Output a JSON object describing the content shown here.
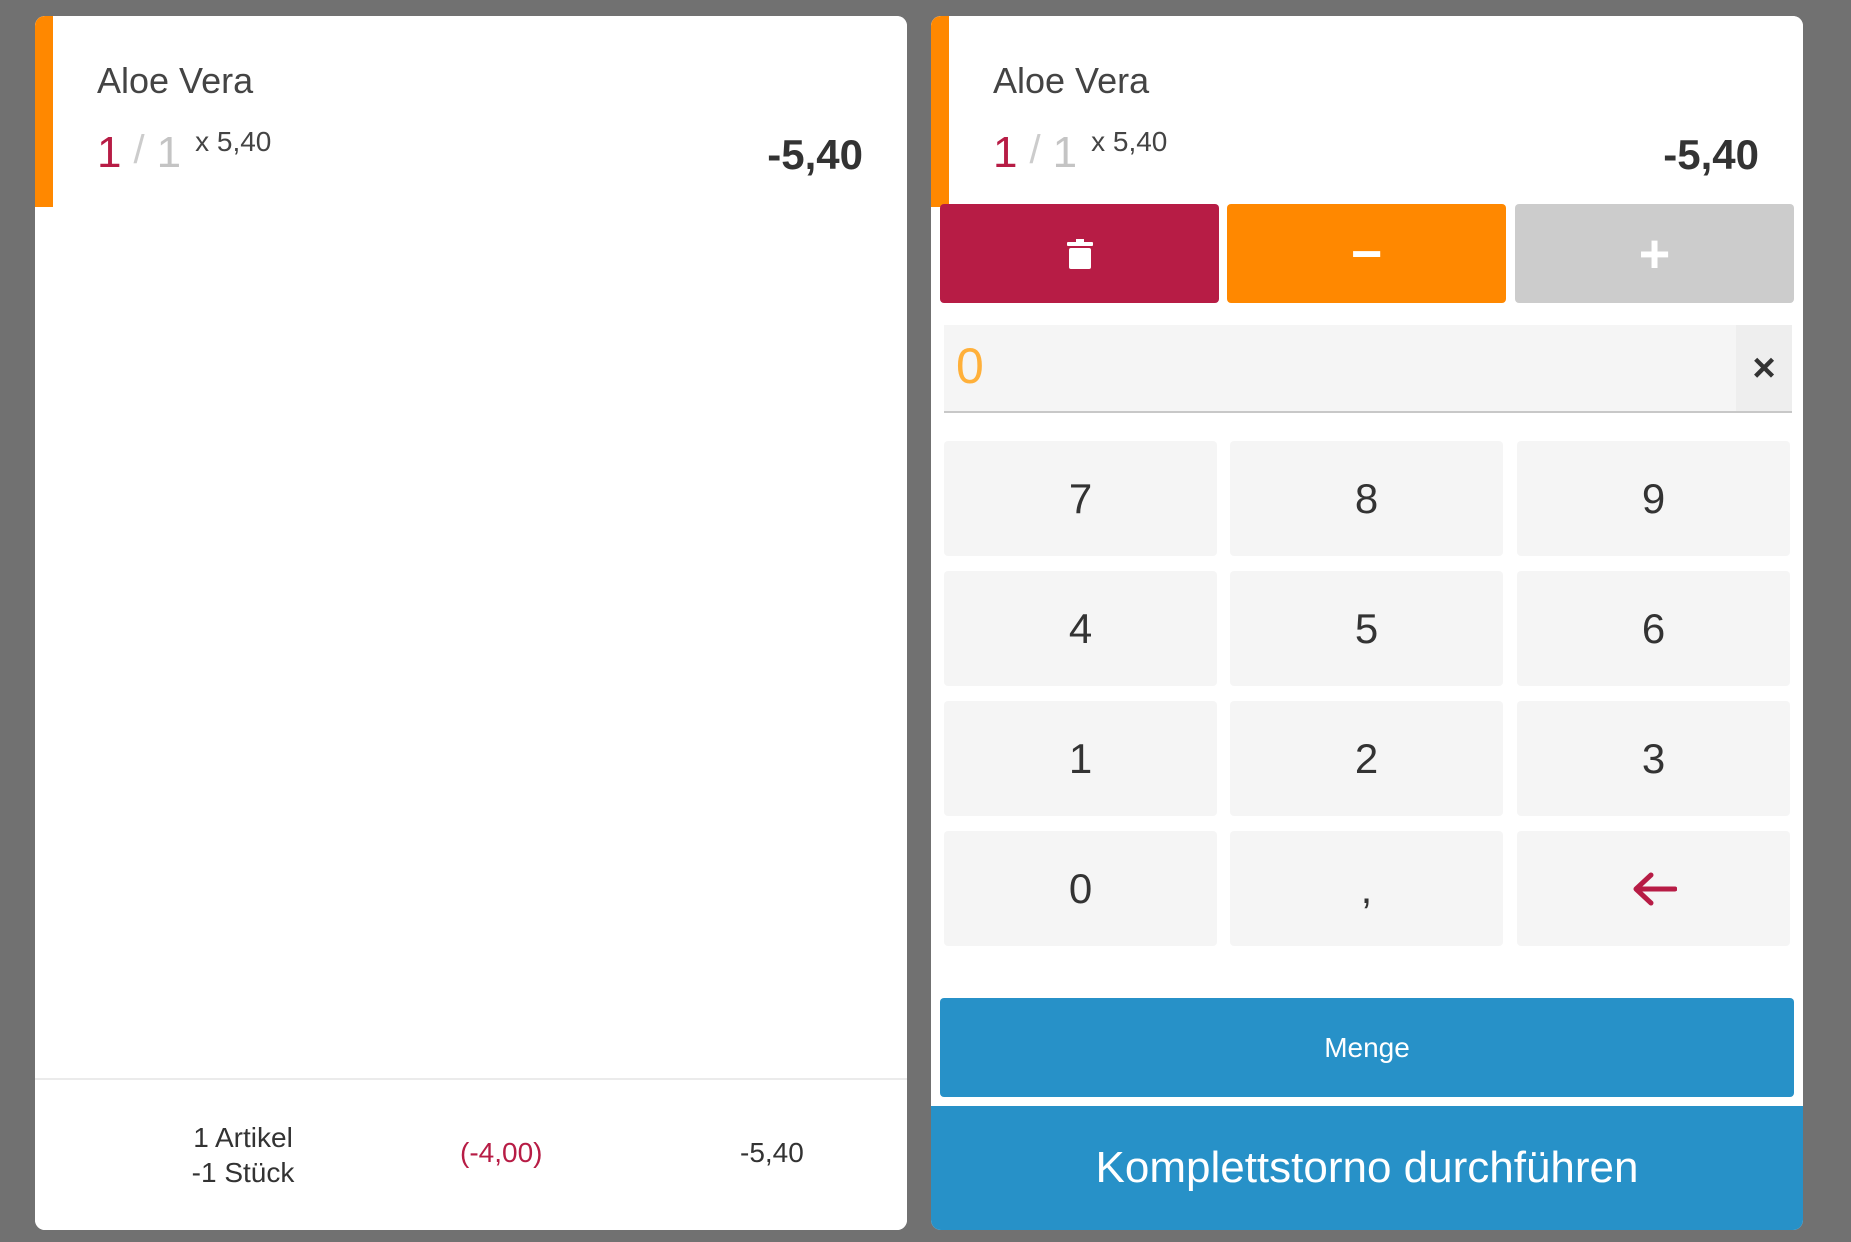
{
  "colors": {
    "background": "#717171",
    "accent": "#ff8800",
    "danger": "#b71c45",
    "primary": "#2791c8",
    "disabled": "#cccccc",
    "input_value": "#ffb03a"
  },
  "left": {
    "item": {
      "name": "Aloe Vera",
      "qty_current": "1",
      "qty_separator": "/",
      "qty_total": "1",
      "unit_price": "x 5,40",
      "price": "-5,40"
    },
    "summary": {
      "articles": "1 Artikel",
      "pieces": "-1 Stück",
      "discount": "(-4,00)",
      "total": "-5,40"
    }
  },
  "right": {
    "item": {
      "name": "Aloe Vera",
      "qty_current": "1",
      "qty_separator": "/",
      "qty_total": "1",
      "unit_price": "x 5,40",
      "price": "-5,40"
    },
    "actions": {
      "delete_icon": "trash-icon",
      "minus_label": "−",
      "plus_label": "+"
    },
    "input": {
      "value": "0",
      "clear_icon": "close-icon",
      "clear_label": "×"
    },
    "keypad": [
      "7",
      "8",
      "9",
      "4",
      "5",
      "6",
      "1",
      "2",
      "3",
      "0",
      ",",
      "←"
    ],
    "menge_label": "Menge",
    "storno_label": "Komplettstorno durchführen"
  }
}
